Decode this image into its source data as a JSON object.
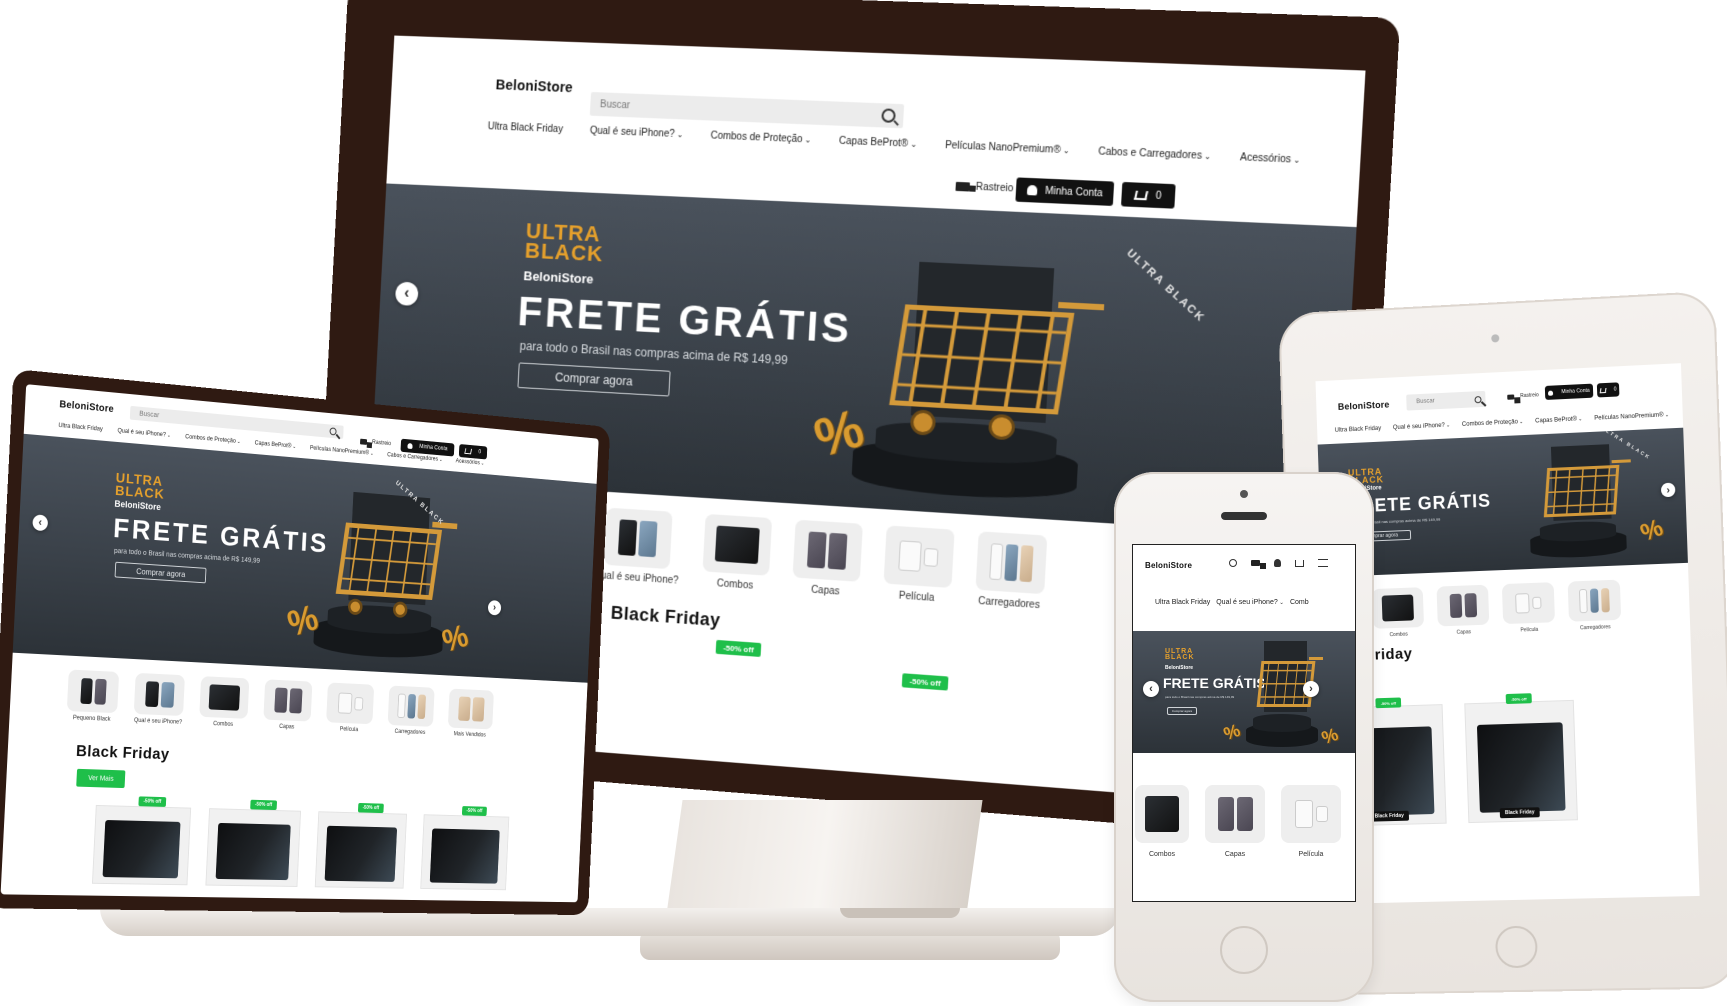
{
  "brand": "BeloniStore",
  "search_placeholder": "Buscar",
  "nav": {
    "ultra": "Ultra Black Friday",
    "qual": "Qual é seu iPhone?",
    "combos": "Combos de Proteção",
    "capas": "Capas BeProt®",
    "peliculas": "Películas NanoPremium®",
    "cabos": "Cabos e Carregadores",
    "acessorios": "Acessórios",
    "phone_combos_cut": "Comb"
  },
  "header": {
    "rastreio": "Rastreio",
    "minha_conta": "Minha Conta",
    "cart_count": "0"
  },
  "hero": {
    "ultra_line1": "ULTRA",
    "ultra_line2": "BLACK",
    "ultra_store": "BeloniStore",
    "title": "FRETE GRÁTIS",
    "subtitle": "para todo o Brasil nas compras acima de R$ 149,99",
    "cta": "Comprar agora",
    "ring_text": "ULTRA BLACK",
    "percent": "%"
  },
  "categories": {
    "pequeno": "Pequeno Black",
    "qual": "Qual é seu iPhone?",
    "combos": "Combos",
    "capas": "Capas",
    "pelicula": "Película",
    "carregadores": "Carregadores",
    "mais_vendidos": "Mais Vendidos"
  },
  "section": {
    "black_friday": "Black Friday",
    "ver_mais": "Ver Mais",
    "discount": "-50% off",
    "discount_small": "-50% off",
    "bf_badge": "Black Friday"
  },
  "arrows": {
    "prev": "‹",
    "next": "›"
  },
  "colors": {
    "accent_gold": "#e5a02c",
    "green": "#1fbf4a",
    "device_brown": "#2f1a12"
  }
}
